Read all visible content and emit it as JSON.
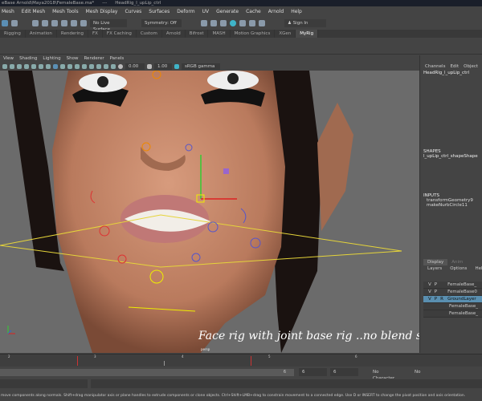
{
  "title": {
    "file": "eBase Arnold\\Maya2018\\FemaleBase.ma*",
    "sep": "---",
    "object": "HeadRig_l_upLip_ctrl"
  },
  "menu": [
    "Mesh",
    "Edit Mesh",
    "Mesh Tools",
    "Mesh Display",
    "Curves",
    "Surfaces",
    "Deform",
    "UV",
    "Generate",
    "Cache",
    "Arnold",
    "Help"
  ],
  "toolbar": {
    "live_surface": "No Live Surface",
    "symmetry": "Symmetry: Off",
    "sign_in": "Sign In"
  },
  "shelf_tabs": [
    "Rigging",
    "Animation",
    "Rendering",
    "FX",
    "FX Caching",
    "Custom",
    "Arnold",
    "Bifrost",
    "MASH",
    "Motion Graphics",
    "XGen",
    "MyRig"
  ],
  "active_shelf": "MyRig",
  "viewport": {
    "menu": [
      "View",
      "Shading",
      "Lighting",
      "Show",
      "Renderer",
      "Panels"
    ],
    "near": "0.00",
    "far": "1.00",
    "color_space": "sRGB gamma",
    "camera": "persp",
    "caption": "Face rig  with joint base rig ..no blend shape ."
  },
  "channel_box": {
    "tabs": [
      "Channels",
      "Edit",
      "Object",
      "S"
    ],
    "node": "HeadRig_l_upLip_ctrl",
    "shapes_header": "SHAPES",
    "shape": "l_upLip_ctrl_shapeShape",
    "inputs_header": "INPUTS",
    "inputs": [
      "transformGeometry9",
      "makeNurbCircle11"
    ]
  },
  "layer_editor": {
    "tabs": [
      "Display",
      "Anim"
    ],
    "menu": [
      "Layers",
      "Options",
      "Help"
    ],
    "layers": [
      {
        "v": "V",
        "p": "P",
        "r": "",
        "name": "FemaleBase_",
        "selected": false
      },
      {
        "v": "V",
        "p": "P",
        "r": "",
        "name": "FemaleBase0",
        "selected": false
      },
      {
        "v": "V",
        "p": "P",
        "r": "R",
        "name": "GroundLayer",
        "selected": true
      },
      {
        "v": "",
        "p": "",
        "r": "",
        "name": "FemaleBase_",
        "selected": false
      },
      {
        "v": "",
        "p": "",
        "r": "",
        "name": "FemaleBase_",
        "selected": false
      }
    ]
  },
  "timeline": {
    "ticks": [
      "2",
      "3",
      "4",
      "5",
      "6"
    ]
  },
  "range": {
    "end": "6",
    "start_field": "6",
    "end_field": "6",
    "character_set": "No Character Set",
    "anim_layer": "No"
  },
  "help_line": "move components along normals. Shift+drag manipulator axis or plane handles to extrude components or clone objects. Ctrl+Shift+LMB+drag to constrain movement to a connected edge. Use D or INSERT to change the pivot position and axis orientation."
}
